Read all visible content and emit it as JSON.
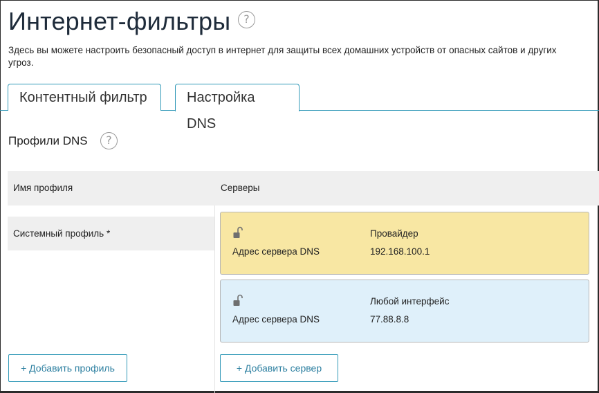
{
  "header": {
    "title": "Интернет-фильтры",
    "help_glyph": "?",
    "description": "Здесь вы можете настроить безопасный доступ в интернет для защиты всех домашних устройств от опасных сайтов и других угроз."
  },
  "tabs": [
    {
      "label": "Контентный фильтр",
      "active": false
    },
    {
      "label": "Настройка DNS",
      "active": true
    }
  ],
  "section": {
    "title": "Профили DNS",
    "help_glyph": "?"
  },
  "table": {
    "columns": [
      "Имя профиля",
      "Серверы"
    ],
    "profiles": [
      {
        "name": "Системный профиль *"
      }
    ],
    "servers": [
      {
        "interface": "Провайдер",
        "label": "Адрес сервера DNS",
        "address": "192.168.100.1",
        "color": "#f8e7a3",
        "icon": "lock-open-icon"
      },
      {
        "interface": "Любой интерфейс",
        "label": "Адрес сервера DNS",
        "address": "77.88.8.8",
        "color": "#dff0fa",
        "icon": "lock-open-icon"
      }
    ]
  },
  "actions": {
    "add_profile": "+ Добавить профиль",
    "add_server": "+ Добавить сервер"
  },
  "colors": {
    "accent": "#2f98b7",
    "title": "#1e2b3a",
    "header_bg": "#efefef"
  }
}
